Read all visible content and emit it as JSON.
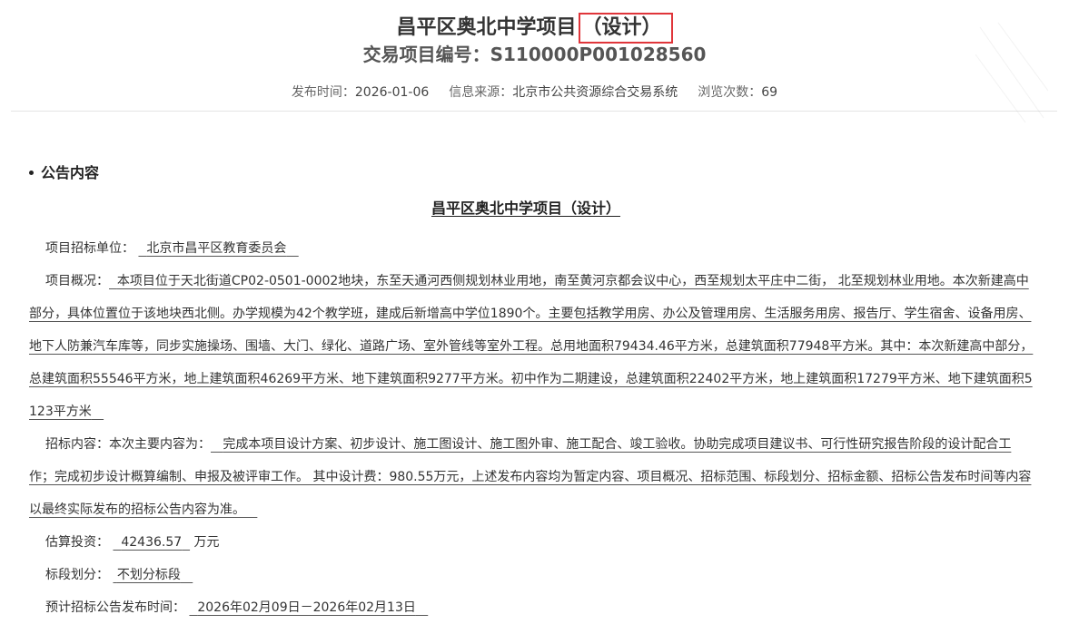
{
  "header": {
    "title_main": "昌平区奥北中学项目",
    "title_paren": "（设计）",
    "project_no_label": "交易项目编号：",
    "project_no_value": "S110000P001028560",
    "publish_label": "发布时间：",
    "publish_value": "2026-01-06",
    "source_label": "信息来源：",
    "source_value": "北京市公共资源综合交易系统",
    "views_label": "浏览次数：",
    "views_value": "69"
  },
  "section": {
    "label": "公告内容"
  },
  "notice": {
    "title": "昌平区奥北中学项目（设计）",
    "unit_label": "项目招标单位：",
    "unit_value": "北京市昌平区教育委员会",
    "overview_label": "项目概况：",
    "overview_value": "本项目位于天北街道CP02-0501-0002地块，东至天通河西侧规划林业用地，南至黄河京都会议中心，西至规划太平庄中二街， 北至规划林业用地。本次新建高中部分，具体位置位于该地块西北侧。办学规模为42个教学班，建成后新增高中学位1890个。主要包括教学用房、办公及管理用房、生活服务用房、报告厅、学生宿舍、设备用房、地下人防兼汽车库等，同步实施操场、围墙、大门、绿化、道路广场、室外管线等室外工程。总用地面积79434.46平方米，总建筑面积77948平方米。其中：本次新建高中部分，总建筑面积55546平方米，地上建筑面积46269平方米、地下建筑面积9277平方米。初中作为二期建设，总建筑面积22402平方米，地上建筑面积17279平方米、地下建筑面积5123平方米",
    "content_label": "招标内容：本次主要内容为：",
    "content_value": "完成本项目设计方案、初步设计、施工图设计、施工图外审、施工配合、竣工验收。协助完成项目建议书、可行性研究报告阶段的设计配合工作；完成初步设计概算编制、申报及被评审工作。 其中设计费：980.55万元，上述发布内容均为暂定内容、项目概况、招标范围、标段划分、招标金额、招标公告发布时间等内容以最终实际发布的招标公告内容为准。",
    "investment_label": "估算投资：",
    "investment_value": "42436.57",
    "investment_unit": "万元",
    "lots_label": "标段划分：",
    "lots_value": "不划分标段",
    "schedule_label": "预计招标公告发布时间：",
    "schedule_value": "2026年02月09日－2026年02月13日"
  }
}
